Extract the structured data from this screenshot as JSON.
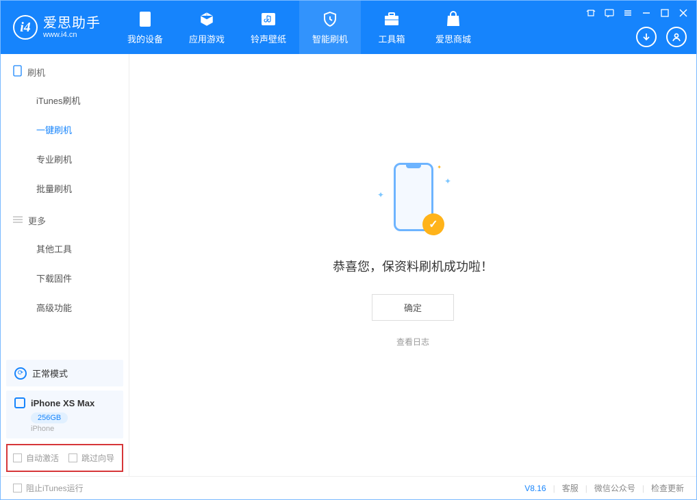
{
  "app": {
    "title": "爱思助手",
    "url": "www.i4.cn",
    "version": "V8.16"
  },
  "nav": {
    "tabs": [
      {
        "label": "我的设备"
      },
      {
        "label": "应用游戏"
      },
      {
        "label": "铃声壁纸"
      },
      {
        "label": "智能刷机"
      },
      {
        "label": "工具箱"
      },
      {
        "label": "爱思商城"
      }
    ],
    "active_index": 3
  },
  "sidebar": {
    "sections": [
      {
        "title": "刷机",
        "items": [
          {
            "label": "iTunes刷机"
          },
          {
            "label": "一键刷机",
            "selected": true
          },
          {
            "label": "专业刷机"
          },
          {
            "label": "批量刷机"
          }
        ]
      },
      {
        "title": "更多",
        "items": [
          {
            "label": "其他工具"
          },
          {
            "label": "下载固件"
          },
          {
            "label": "高级功能"
          }
        ]
      }
    ],
    "mode": {
      "label": "正常模式"
    },
    "device": {
      "name": "iPhone XS Max",
      "storage": "256GB",
      "type": "iPhone"
    },
    "options": [
      {
        "label": "自动激活",
        "checked": false
      },
      {
        "label": "跳过向导",
        "checked": false
      }
    ]
  },
  "main": {
    "success_message": "恭喜您，保资料刷机成功啦！",
    "ok_button": "确定",
    "log_link": "查看日志"
  },
  "footer": {
    "block_itunes_label": "阻止iTunes运行",
    "links": [
      "客服",
      "微信公众号",
      "检查更新"
    ]
  }
}
